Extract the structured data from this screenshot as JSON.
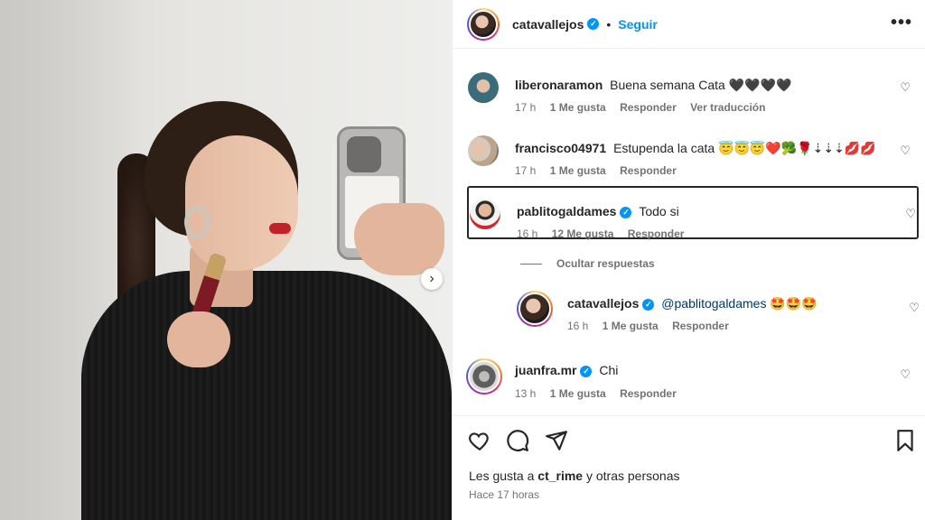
{
  "post": {
    "author": "catavallejos",
    "follow_label": "Seguir",
    "separator": "•",
    "more_label": "•••"
  },
  "comments": [
    {
      "user": "liberonaramon",
      "text": "Buena semana Cata 🖤🖤🖤🖤",
      "time": "17 h",
      "likes": "1 Me gusta",
      "reply": "Responder",
      "translate": "Ver traducción"
    },
    {
      "user": "francisco04971",
      "text": "Estupenda la cata 😇😇😇❤️🥦🌹⇣⇣⇣💋💋",
      "time": "17 h",
      "likes": "1 Me gusta",
      "reply": "Responder"
    },
    {
      "user": "pablitogaldames",
      "text": "Todo si",
      "time": "16 h",
      "likes": "12 Me gusta",
      "reply": "Responder"
    },
    {
      "user": "catavallejos",
      "mention": "@pablitogaldames",
      "text": "🤩🤩🤩",
      "time": "16 h",
      "likes": "1 Me gusta",
      "reply": "Responder"
    },
    {
      "user": "juanfra.mr",
      "text": "Chi",
      "time": "13 h",
      "likes": "1 Me gusta",
      "reply": "Responder"
    }
  ],
  "hide_replies": "Ocultar respuestas",
  "footer": {
    "likes_prefix": "Les gusta a",
    "likes_user": "ct_rime",
    "likes_suffix": "y otras personas",
    "posted": "Hace 17 horas"
  },
  "icons": {
    "heart": "heart-icon",
    "comment": "comment-icon",
    "share": "share-icon",
    "save": "bookmark-icon",
    "verified": "verified-icon"
  },
  "colors": {
    "accent": "#0095f6",
    "text": "#262626",
    "muted": "#737373"
  }
}
